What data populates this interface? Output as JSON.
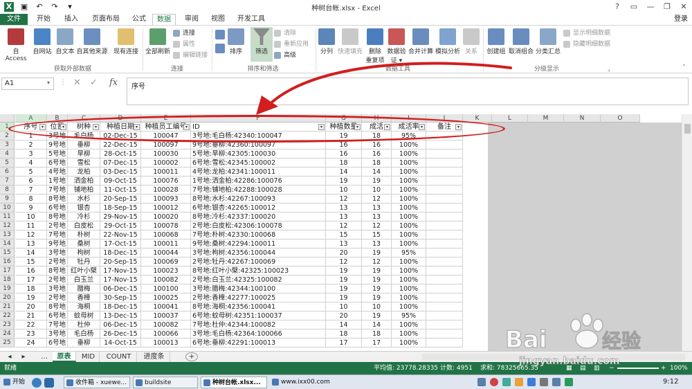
{
  "window": {
    "title": "种树台帐.xlsx - Excel",
    "help": "?",
    "login": "登录"
  },
  "tabs": [
    "文件",
    "开始",
    "插入",
    "页面布局",
    "公式",
    "数据",
    "审阅",
    "视图",
    "开发工具"
  ],
  "ribbon": {
    "get_external": {
      "access": "自 Access",
      "web": "自网站",
      "text": "自文本",
      "other": "自其他来源",
      "existing": "现有连接",
      "group": "获取外部数据"
    },
    "connections": {
      "refresh_all": "全部刷新",
      "conn": "连接",
      "props": "属性",
      "edit_links": "编辑链接",
      "group": "连接"
    },
    "sort_filter": {
      "sort": "排序",
      "filter": "筛选",
      "clear": "清除",
      "reapply": "重新应用",
      "advanced": "高级",
      "group": "排序和筛选"
    },
    "data_tools": {
      "split": "分列",
      "flash_fill": "快速填充",
      "remove_dup_1": "删除",
      "remove_dup_2": "重复项",
      "validation_1": "数据验",
      "validation_2": "证 ▾",
      "consolidate": "合并计算",
      "whatif": "模拟分析",
      "relations": "关系",
      "group": "数据工具"
    },
    "outline": {
      "group_btn": "创建组",
      "ungroup": "取消组合",
      "subtotal": "分类汇总",
      "show_detail": "显示明细数据",
      "hide_detail": "隐藏明细数据",
      "group": "分级显示"
    }
  },
  "formula_bar": {
    "name_box": "A1",
    "fx": "fx",
    "content": "序号"
  },
  "columns": [
    "A",
    "B",
    "C",
    "D",
    "E",
    "F",
    "G",
    "H",
    "I",
    "J",
    "K",
    "L",
    "M",
    "N",
    "O"
  ],
  "headers": [
    "序号",
    "位置",
    "树种",
    "种植日期",
    "种植员工编号",
    "ID",
    "种植数量",
    "成活",
    "成活率",
    "备注"
  ],
  "rows": [
    [
      "1",
      "3号地",
      "毛白杨",
      "02-Dec-15",
      "100047",
      "3号地:毛白杨:42340:100047",
      "19",
      "18",
      "95%"
    ],
    [
      "2",
      "9号地",
      "垂柳",
      "22-Dec-15",
      "100097",
      "9号地:垂柳:42360:100097",
      "16",
      "16",
      "100%"
    ],
    [
      "3",
      "5号地",
      "旱柳",
      "28-Oct-15",
      "100030",
      "5号地:旱柳:42305:100030",
      "16",
      "16",
      "100%"
    ],
    [
      "4",
      "6号地",
      "雪松",
      "07-Dec-15",
      "100002",
      "6号地:雪松:42345:100002",
      "18",
      "18",
      "100%"
    ],
    [
      "5",
      "4号地",
      "龙柏",
      "03-Dec-15",
      "100011",
      "4号地:龙柏:42341:100011",
      "14",
      "14",
      "100%"
    ],
    [
      "6",
      "1号地",
      "洒金柏",
      "09-Oct-15",
      "100076",
      "1号地:洒金柏:42286:100076",
      "19",
      "19",
      "100%"
    ],
    [
      "7",
      "7号地",
      "铺地柏",
      "11-Oct-15",
      "100028",
      "7号地:铺地柏:42288:100028",
      "10",
      "10",
      "100%"
    ],
    [
      "8",
      "8号地",
      "水杉",
      "20-Sep-15",
      "100093",
      "8号地:水杉:42267:100093",
      "12",
      "12",
      "100%"
    ],
    [
      "9",
      "6号地",
      "银杏",
      "18-Sep-15",
      "100012",
      "6号地:银杏:42265:100012",
      "13",
      "13",
      "100%"
    ],
    [
      "10",
      "8号地",
      "冷杉",
      "29-Nov-15",
      "100020",
      "8号地:冷杉:42337:100020",
      "13",
      "13",
      "100%"
    ],
    [
      "11",
      "2号地",
      "白皮松",
      "29-Oct-15",
      "100078",
      "2号地:白皮松:42306:100078",
      "12",
      "12",
      "100%"
    ],
    [
      "12",
      "7号地",
      "朴树",
      "22-Nov-15",
      "100068",
      "7号地:朴树:42330:100068",
      "15",
      "15",
      "100%"
    ],
    [
      "13",
      "9号地",
      "桑树",
      "17-Oct-15",
      "100011",
      "9号地:桑树:42294:100011",
      "13",
      "13",
      "100%"
    ],
    [
      "14",
      "3号地",
      "枸树",
      "18-Dec-15",
      "100044",
      "3号地:枸树:42356:100044",
      "20",
      "19",
      "95%"
    ],
    [
      "15",
      "2号地",
      "牡丹",
      "20-Sep-15",
      "100069",
      "2号地:牡丹:42267:100069",
      "12",
      "12",
      "100%"
    ],
    [
      "16",
      "8号地",
      "红叶小檗",
      "17-Nov-15",
      "100023",
      "8号地:红叶小檗:42325:100023",
      "19",
      "19",
      "100%"
    ],
    [
      "17",
      "2号地",
      "白玉兰",
      "17-Nov-15",
      "100082",
      "2号地:白玉兰:42325:100082",
      "19",
      "19",
      "100%"
    ],
    [
      "18",
      "3号地",
      "腊梅",
      "06-Dec-15",
      "100100",
      "3号地:腊梅:42344:100100",
      "19",
      "19",
      "100%"
    ],
    [
      "19",
      "2号地",
      "香樟",
      "30-Sep-15",
      "100025",
      "2号地:香樟:42277:100025",
      "19",
      "19",
      "100%"
    ],
    [
      "20",
      "8号地",
      "海桐",
      "18-Dec-15",
      "100041",
      "8号地:海桐:42356:100041",
      "10",
      "10",
      "100%"
    ],
    [
      "21",
      "6号地",
      "蚊母树",
      "13-Dec-15",
      "100037",
      "6号地:蚊母树:42351:100037",
      "20",
      "19",
      "95%"
    ],
    [
      "22",
      "7号地",
      "杜仲",
      "06-Dec-15",
      "100082",
      "7号地:杜仲:42344:100082",
      "14",
      "14",
      "100%"
    ],
    [
      "23",
      "3号地",
      "毛白杨",
      "26-Dec-15",
      "100066",
      "3号地:毛白杨:42364:100066",
      "18",
      "18",
      "100%"
    ],
    [
      "24",
      "6号地",
      "垂柳",
      "14-Oct-15",
      "100013",
      "6号地:垂柳:42291:100013",
      "17",
      "17",
      "100%"
    ]
  ],
  "sheet_tabs": [
    "原表",
    "MID",
    "COUNT",
    "进度条"
  ],
  "status": {
    "mode": "就绪",
    "average": "平均值: 23778.28335",
    "count": "计数: 4951",
    "sum": "求和: 78325665.35",
    "zoom": "100%"
  },
  "taskbar": {
    "start": "开始",
    "items": [
      "收件箱 - xuewe...",
      "buildsite",
      "种树台帐.xlsx...",
      "www.ixx00.com"
    ],
    "clock": "9:12"
  },
  "watermark": {
    "brand": "Bai",
    "brand_cn": "经验",
    "url": "jingyan.baidu.com"
  },
  "colors": {
    "excel_green": "#217346",
    "annotation_red": "#d21e1e",
    "empty_area": "#d0d0d0"
  }
}
